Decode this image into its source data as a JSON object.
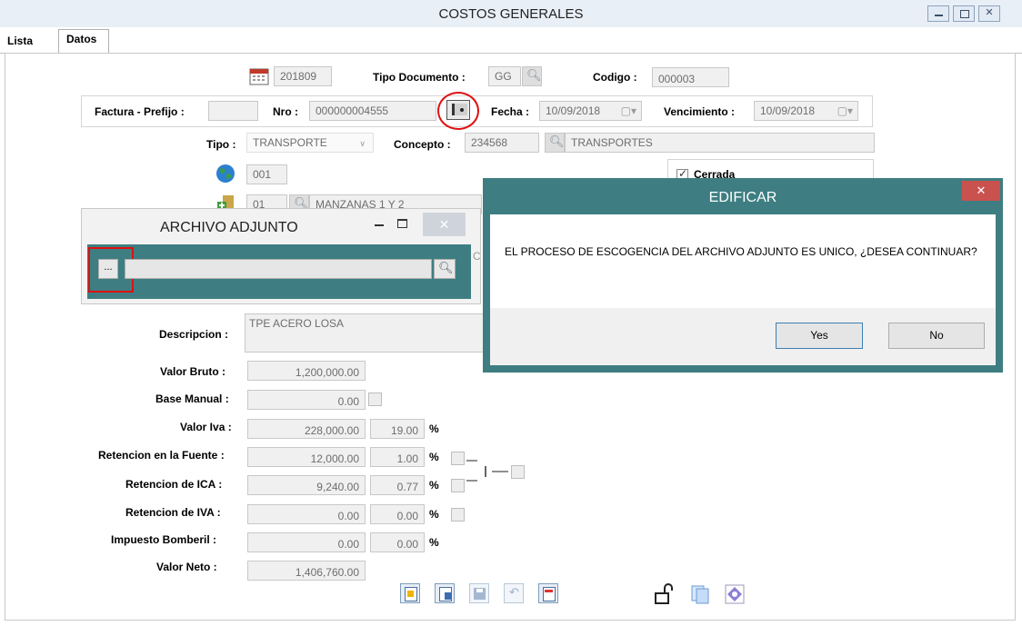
{
  "window": {
    "title": "COSTOS GENERALES"
  },
  "tabs": [
    {
      "label": "Lista"
    },
    {
      "label": "Datos"
    }
  ],
  "header": {
    "period": "201809",
    "tipo_documento_label": "Tipo Documento :",
    "tipo_documento_value": "GG",
    "codigo_label": "Codigo :",
    "codigo_value": "000003",
    "factura_prefijo_label": "Factura - Prefijo :",
    "nro_label": "Nro :",
    "nro_value": "000000004555",
    "fecha_label": "Fecha :",
    "fecha_value": "10/09/2018",
    "vencimiento_label": "Vencimiento :",
    "vencimiento_value": "10/09/2018",
    "tipo_label": "Tipo :",
    "tipo_value": "TRANSPORTE",
    "concepto_label": "Concepto :",
    "concepto_value": "234568",
    "concepto_desc": "TRANSPORTES",
    "globe_value": "001",
    "cerrada_label": "Cerrada",
    "cerrada_checked": true,
    "proyecto_value": "01",
    "proyecto_desc": "MANZANAS 1 Y 2"
  },
  "archivo_adjunto": {
    "title": "ARCHIVO ADJUNTO",
    "browse_label": "...",
    "path_value": ""
  },
  "dialog": {
    "title": "EDIFICAR",
    "message": "EL PROCESO DE ESCOGENCIA DEL ARCHIVO ADJUNTO ES UNICO, ¿DESEA CONTINUAR?",
    "yes_label": "Yes",
    "no_label": "No"
  },
  "values": {
    "descripcion_label": "Descripcion :",
    "descripcion_value": "TPE ACERO LOSA",
    "valor_bruto_label": "Valor Bruto :",
    "valor_bruto": "1,200,000.00",
    "base_manual_label": "Base Manual :",
    "base_manual": "0.00",
    "valor_iva_label": "Valor Iva :",
    "valor_iva": "228,000.00",
    "valor_iva_pct": "19.00",
    "ret_fuente_label": "Retencion en la Fuente :",
    "ret_fuente": "12,000.00",
    "ret_fuente_pct": "1.00",
    "ret_ica_label": "Retencion de ICA :",
    "ret_ica": "9,240.00",
    "ret_ica_pct": "0.77",
    "ret_iva_label": "Retencion de IVA :",
    "ret_iva": "0.00",
    "ret_iva_pct": "0.00",
    "bomberil_label": "Impuesto Bomberil :",
    "bomberil": "0.00",
    "bomberil_pct": "0.00",
    "valor_neto_label": "Valor Neto :",
    "valor_neto": "1,406,760.00",
    "pct_symbol": "%"
  },
  "colors": {
    "dialog_teal": "#3e7e82",
    "highlight_red": "#e01010",
    "titlebar": "#e9eff7"
  }
}
